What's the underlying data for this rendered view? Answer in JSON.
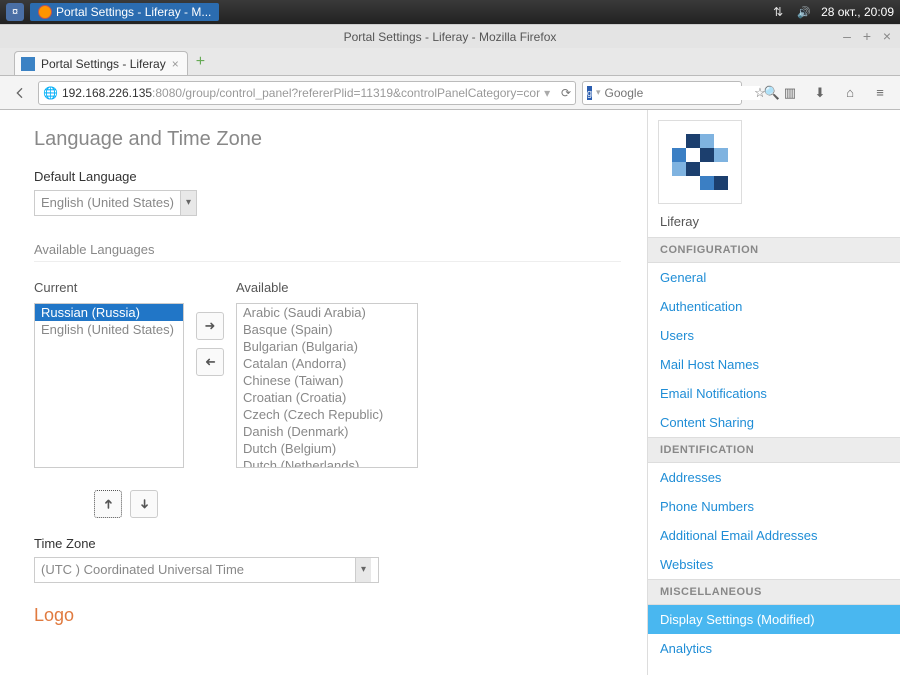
{
  "os": {
    "task_title": "Portal Settings - Liferay - M...",
    "clock": "28 окт., 20:09"
  },
  "firefox": {
    "window_title": "Portal Settings - Liferay - Mozilla Firefox",
    "tab_title": "Portal Settings - Liferay",
    "url_host": "192.168.226.135",
    "url_path": ":8080/group/control_panel?refererPlid=11319&controlPanelCategory=cor",
    "search_placeholder": "Google"
  },
  "page": {
    "title": "Language and Time Zone",
    "default_language_label": "Default Language",
    "default_language_value": "English (United States)",
    "available_languages_label": "Available Languages",
    "current_header": "Current",
    "available_header": "Available",
    "current_list": [
      "Russian (Russia)",
      "English (United States)"
    ],
    "available_list": [
      "Arabic (Saudi Arabia)",
      "Basque (Spain)",
      "Bulgarian (Bulgaria)",
      "Catalan (Andorra)",
      "Chinese (Taiwan)",
      "Croatian (Croatia)",
      "Czech (Czech Republic)",
      "Danish (Denmark)",
      "Dutch (Belgium)",
      "Dutch (Netherlands)"
    ],
    "timezone_label": "Time Zone",
    "timezone_value": "(UTC ) Coordinated Universal Time",
    "logo_label": "Logo"
  },
  "sidebar": {
    "portal_name": "Liferay",
    "groups": [
      {
        "header": "CONFIGURATION",
        "items": [
          "General",
          "Authentication",
          "Users",
          "Mail Host Names",
          "Email Notifications",
          "Content Sharing"
        ]
      },
      {
        "header": "IDENTIFICATION",
        "items": [
          "Addresses",
          "Phone Numbers",
          "Additional Email Addresses",
          "Websites"
        ]
      },
      {
        "header": "MISCELLANEOUS",
        "items": [
          "Display Settings (Modified)",
          "Analytics"
        ]
      }
    ],
    "active_item": "Display Settings (Modified)"
  }
}
